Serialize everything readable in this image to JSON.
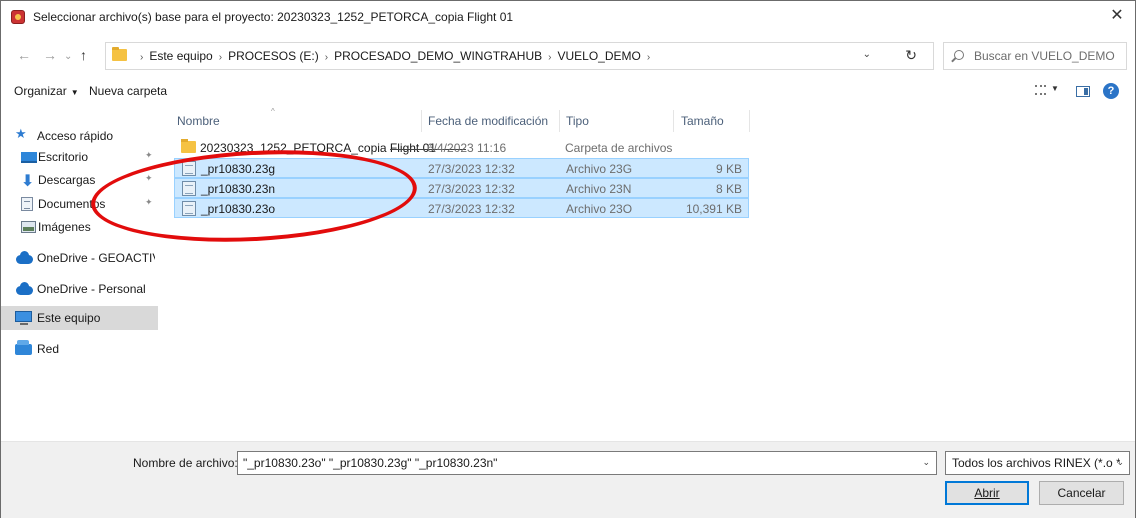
{
  "window": {
    "title": "Seleccionar archivo(s) base para el proyecto: 20230323_1252_PETORCA_copia Flight 01",
    "close_label": "✕"
  },
  "nav": {
    "back": "←",
    "forward": "→",
    "history": "⌄",
    "up": "↑"
  },
  "address": {
    "crumbs": [
      "Este equipo",
      "PROCESOS (E:)",
      "PROCESADO_DEMO_WINGTRAHUB",
      "VUELO_DEMO"
    ],
    "separator": "›",
    "dropdown": "⌄",
    "refresh": "↻"
  },
  "search": {
    "placeholder": "Buscar en VUELO_DEMO"
  },
  "toolbar": {
    "organize_label": "Organizar",
    "organize_caret": "▼",
    "new_folder_label": "Nueva carpeta",
    "view_caret": "▼",
    "help_label": "?"
  },
  "sidebar": {
    "items": [
      {
        "label": "Acceso rápido",
        "icon": "star-icon"
      },
      {
        "label": "Escritorio",
        "icon": "desktop-icon",
        "pinned": true
      },
      {
        "label": "Descargas",
        "icon": "download-icon",
        "pinned": true
      },
      {
        "label": "Documentos",
        "icon": "documents-icon",
        "pinned": true
      },
      {
        "label": "Imágenes",
        "icon": "pictures-icon",
        "pinned": true
      },
      {
        "label": "OneDrive - GEOACTIV",
        "icon": "onedrive-icon"
      },
      {
        "label": "OneDrive - Personal",
        "icon": "onedrive-icon"
      },
      {
        "label": "Este equipo",
        "icon": "computer-icon",
        "selected": true
      },
      {
        "label": "Red",
        "icon": "network-icon"
      }
    ],
    "pin_glyph": "📌"
  },
  "columns": {
    "name": "Nombre",
    "date": "Fecha de modificación",
    "type": "Tipo",
    "size": "Tamaño",
    "sort_caret": "^"
  },
  "files": [
    {
      "name": "20230323_1252_PETORCA_copia Flight 01",
      "date": "6/4/2023 11:16",
      "type": "Carpeta de archivos",
      "size": "",
      "kind": "folder",
      "selected": false
    },
    {
      "name": "_pr10830.23g",
      "date": "27/3/2023 12:32",
      "type": "Archivo 23G",
      "size": "9 KB",
      "kind": "file",
      "selected": true
    },
    {
      "name": "_pr10830.23n",
      "date": "27/3/2023 12:32",
      "type": "Archivo 23N",
      "size": "8 KB",
      "kind": "file",
      "selected": true
    },
    {
      "name": "_pr10830.23o",
      "date": "27/3/2023 12:32",
      "type": "Archivo 23O",
      "size": "10,391 KB",
      "kind": "file",
      "selected": true
    }
  ],
  "annotation_color": "#e20c0c",
  "bottom": {
    "filename_label": "Nombre de archivo:",
    "filename_value": "\"_pr10830.23o\" \"_pr10830.23g\" \"_pr10830.23n\"",
    "filename_dropdown": "⌄",
    "filter_value": "Todos los archivos RINEX (*.o *.",
    "filter_dropdown": "⌄",
    "open_label": "Abrir",
    "cancel_label": "Cancelar"
  },
  "colors": {
    "selection_bg": "#cce8ff",
    "selection_border": "#99d1ff",
    "accent": "#0078d7"
  }
}
